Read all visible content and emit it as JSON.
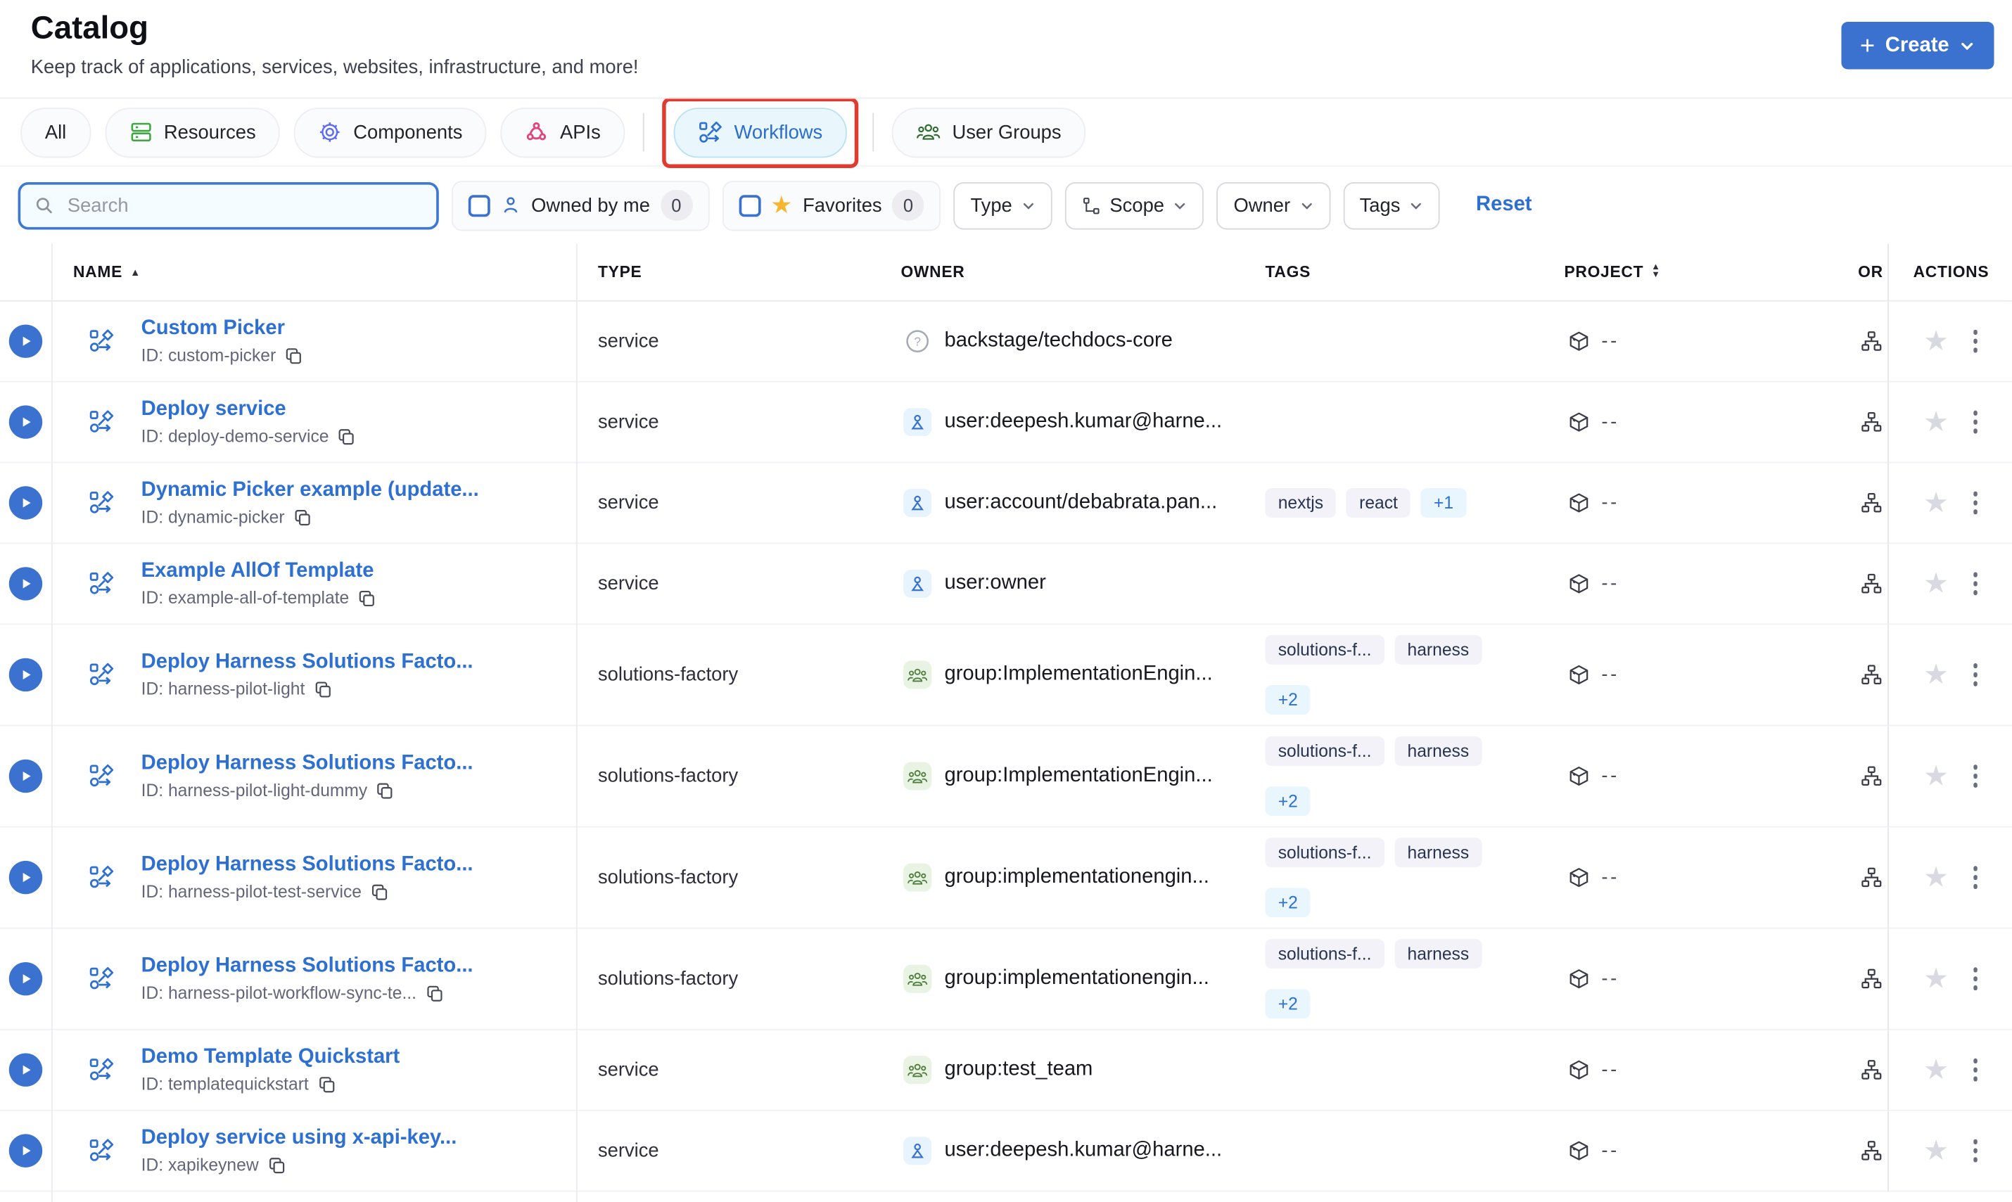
{
  "page": {
    "title": "Catalog",
    "subtitle": "Keep track of applications, services, websites, infrastructure, and more!"
  },
  "create_button": {
    "label": "Create"
  },
  "tabs": [
    {
      "label": "All"
    },
    {
      "label": "Resources",
      "icon": "resources-icon"
    },
    {
      "label": "Components",
      "icon": "components-icon"
    },
    {
      "label": "APIs",
      "icon": "apis-icon"
    },
    {
      "label": "Workflows",
      "icon": "workflows-icon",
      "active": true,
      "annotated": true
    },
    {
      "label": "User Groups",
      "icon": "user-groups-icon"
    }
  ],
  "filters": {
    "search_placeholder": "Search",
    "owned_by_me": {
      "label": "Owned by me",
      "count": "0"
    },
    "favorites": {
      "label": "Favorites",
      "count": "0"
    },
    "type_label": "Type",
    "scope_label": "Scope",
    "owner_label": "Owner",
    "tags_label": "Tags",
    "reset_label": "Reset"
  },
  "table": {
    "headers": {
      "name": "NAME",
      "type": "TYPE",
      "owner": "OWNER",
      "tags": "TAGS",
      "project": "PROJECT",
      "origin": "OR",
      "actions": "ACTIONS"
    },
    "rows": [
      {
        "name": "Custom Picker",
        "id": "ID: custom-picker",
        "type": "service",
        "owner": "backstage/techdocs-core",
        "owner_kind": "unknown",
        "tags": [],
        "more": "",
        "project": "--"
      },
      {
        "name": "Deploy service",
        "id": "ID: deploy-demo-service",
        "type": "service",
        "owner": "user:deepesh.kumar@harne...",
        "owner_kind": "user",
        "tags": [],
        "more": "",
        "project": "--"
      },
      {
        "name": "Dynamic Picker example (update...",
        "id": "ID: dynamic-picker",
        "type": "service",
        "owner": "user:account/debabrata.pan...",
        "owner_kind": "user",
        "tags": [
          "nextjs",
          "react"
        ],
        "more": "+1",
        "project": "--"
      },
      {
        "name": "Example AllOf Template",
        "id": "ID: example-all-of-template",
        "type": "service",
        "owner": "user:owner",
        "owner_kind": "user",
        "tags": [],
        "more": "",
        "project": "--"
      },
      {
        "name": "Deploy Harness Solutions Facto...",
        "id": "ID: harness-pilot-light",
        "type": "solutions-factory",
        "owner": "group:ImplementationEngin...",
        "owner_kind": "group",
        "tags": [
          "solutions-f...",
          "harness"
        ],
        "more": "+2",
        "wrap": true,
        "project": "--"
      },
      {
        "name": "Deploy Harness Solutions Facto...",
        "id": "ID: harness-pilot-light-dummy",
        "type": "solutions-factory",
        "owner": "group:ImplementationEngin...",
        "owner_kind": "group",
        "tags": [
          "solutions-f...",
          "harness"
        ],
        "more": "+2",
        "wrap": true,
        "project": "--"
      },
      {
        "name": "Deploy Harness Solutions Facto...",
        "id": "ID: harness-pilot-test-service",
        "type": "solutions-factory",
        "owner": "group:implementationengin...",
        "owner_kind": "group",
        "tags": [
          "solutions-f...",
          "harness"
        ],
        "more": "+2",
        "wrap": true,
        "project": "--"
      },
      {
        "name": "Deploy Harness Solutions Facto...",
        "id": "ID: harness-pilot-workflow-sync-te...",
        "type": "solutions-factory",
        "owner": "group:implementationengin...",
        "owner_kind": "group",
        "tags": [
          "solutions-f...",
          "harness"
        ],
        "more": "+2",
        "wrap": true,
        "project": "--"
      },
      {
        "name": "Demo Template Quickstart",
        "id": "ID: templatequickstart",
        "type": "service",
        "owner": "group:test_team",
        "owner_kind": "group",
        "tags": [],
        "more": "",
        "project": "--"
      },
      {
        "name": "Deploy service using x-api-key...",
        "id": "ID: xapikeynew",
        "type": "service",
        "owner": "user:deepesh.kumar@harne...",
        "owner_kind": "user",
        "tags": [],
        "more": "",
        "project": "--"
      }
    ]
  },
  "colors": {
    "accent_blue": "#3b72d0",
    "link_blue": "#2e6fd2",
    "active_tab_bg": "#e9f7fd",
    "annotation_red": "#e23a2e",
    "favorite_gold": "#f6b62e",
    "resources_green": "#3fa73f",
    "components_indigo": "#5d6af8",
    "apis_pink": "#e0457e",
    "user_groups_green": "#2e6b2e",
    "tag_bg": "#f2f2f8",
    "more_tag_bg": "#e9f6fd",
    "inactive_star_gray": "#d8d9e1"
  }
}
